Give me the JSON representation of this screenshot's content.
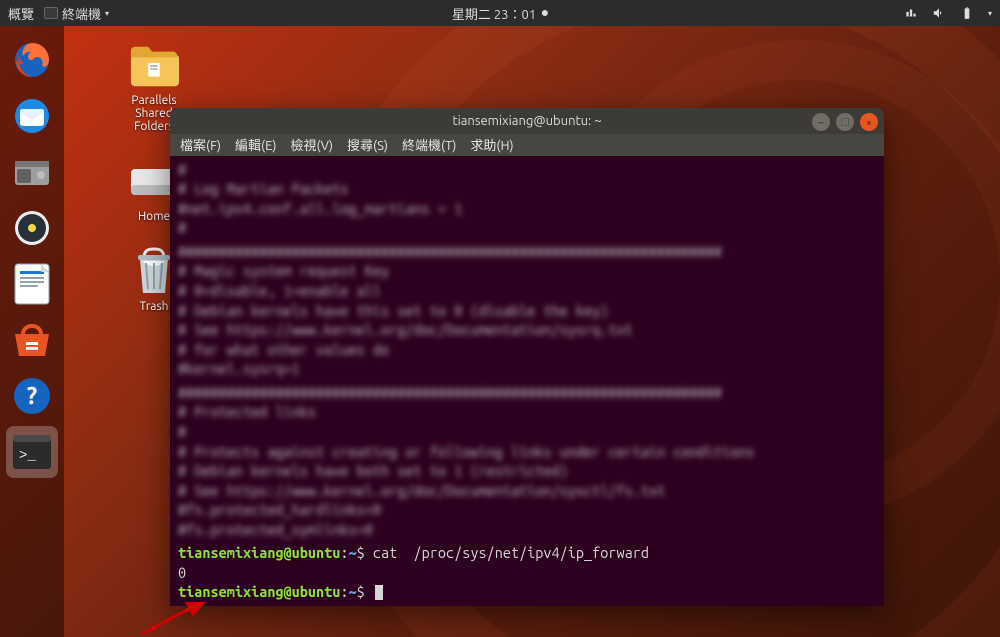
{
  "panel": {
    "activities": "概覽",
    "app_indicator": "終端機",
    "clock": "星期二 23：01",
    "tray": {
      "network": "network-icon",
      "sound": "sound-icon",
      "battery": "battery-icon",
      "caret": "▾"
    }
  },
  "dock": [
    {
      "name": "firefox",
      "label": "Firefox"
    },
    {
      "name": "thunderbird",
      "label": "Thunderbird"
    },
    {
      "name": "files",
      "label": "Files"
    },
    {
      "name": "rhythmbox",
      "label": "Rhythmbox"
    },
    {
      "name": "writer",
      "label": "LibreOffice Writer"
    },
    {
      "name": "software",
      "label": "Ubuntu Software"
    },
    {
      "name": "help",
      "label": "Help"
    },
    {
      "name": "terminal",
      "label": "Terminal",
      "active": true
    }
  ],
  "desktop_icons": [
    {
      "name": "parallels-shared-folders",
      "label": "Parallels\nShared\nFolders"
    },
    {
      "name": "home",
      "label": "Home"
    },
    {
      "name": "trash",
      "label": "Trash"
    }
  ],
  "window": {
    "title": "tiansemixiang@ubuntu: ~",
    "menu": {
      "file": "檔案(F)",
      "edit": "編輯(E)",
      "view": "檢視(V)",
      "search": "搜尋(S)",
      "terminal": "終端機(T)",
      "help": "求助(H)"
    },
    "controls": {
      "min": "–",
      "max": "▢",
      "close": "×"
    }
  },
  "terminal": {
    "blurred_chunks": [
      "#\n# Log Martian Packets\n#net.ipv4.conf.all.log_martians = 1\n#",
      "###################################################################\n# Magic system request Key\n# 0=disable, 1=enable all\n# Debian kernels have this set to 0 (disable the key)\n# See https://www.kernel.org/doc/Documentation/sysrq.txt\n# for what other values do\n#kernel.sysrq=1",
      "###################################################################\n# Protected links\n#\n# Protects against creating or following links under certain conditions\n# Debian kernels have both set to 1 (restricted)\n# See https://www.kernel.org/doc/Documentation/sysctl/fs.txt\n#fs.protected_hardlinks=0\n#fs.protected_symlinks=0"
    ],
    "prompt_user": "tiansemixiang@ubuntu",
    "prompt_sep": ":",
    "prompt_path": "~",
    "prompt_sigil": "$",
    "command": "cat  /proc/sys/net/ipv4/ip_forward",
    "output": "0"
  }
}
